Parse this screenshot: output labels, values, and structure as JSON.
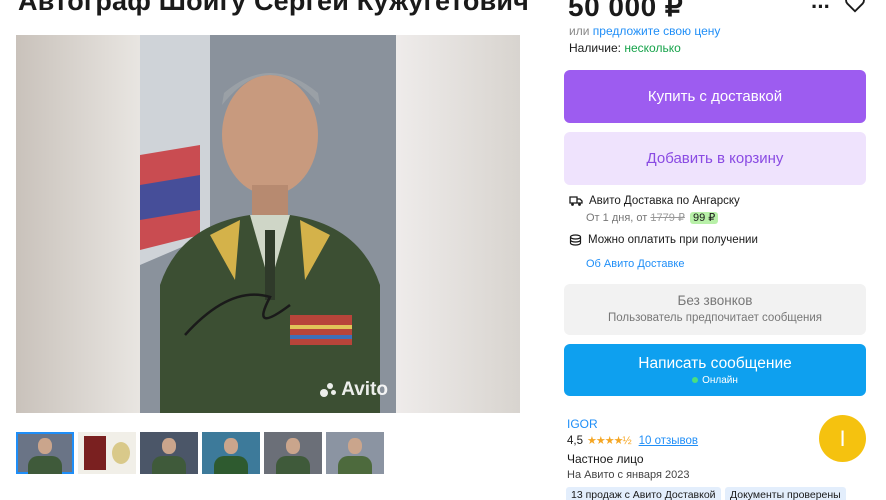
{
  "listing": {
    "title": "Автограф Шойгу Сергей Кужугетович",
    "watermark": "Avito",
    "thumbnail_count": 6
  },
  "price": {
    "amount": "50 000 ₽",
    "alt_prefix": "или",
    "alt_link": "предложите свою цену",
    "stock_label": "Наличие:",
    "stock_value": "несколько"
  },
  "actions": {
    "buy_label": "Купить с доставкой",
    "cart_label": "Добавить в корзину",
    "message_label": "Написать сообщение",
    "message_status": "Онлайн"
  },
  "delivery": {
    "title": "Авито Доставка по Ангарску",
    "sub_prefix": "От 1 дня, от",
    "old_price": "1779 ₽",
    "new_price": "99 ₽",
    "cod_label": "Можно оплатить при получении",
    "info_link": "Об Авито Доставке"
  },
  "no_calls": {
    "title": "Без звонков",
    "subtitle": "Пользователь предпочитает сообщения"
  },
  "seller": {
    "name": "IGOR",
    "rating": "4,5",
    "stars": "★★★★½",
    "reviews": "10 отзывов",
    "type": "Частное лицо",
    "since": "На Авито с января 2023",
    "avatar_letter": "I",
    "tags": [
      "13 продаж с Авито Доставкой",
      "Документы проверены"
    ]
  },
  "icons": {
    "more": "more-dots-icon",
    "favorite": "heart-icon",
    "delivery": "truck-icon",
    "cash": "coins-icon"
  },
  "colors": {
    "buy": "#9d5cf0",
    "cart_bg": "#efe3fd",
    "message": "#0ea0ef",
    "link": "#1f8ef7",
    "in_stock": "#16a34a",
    "avatar": "#f5c20f"
  }
}
